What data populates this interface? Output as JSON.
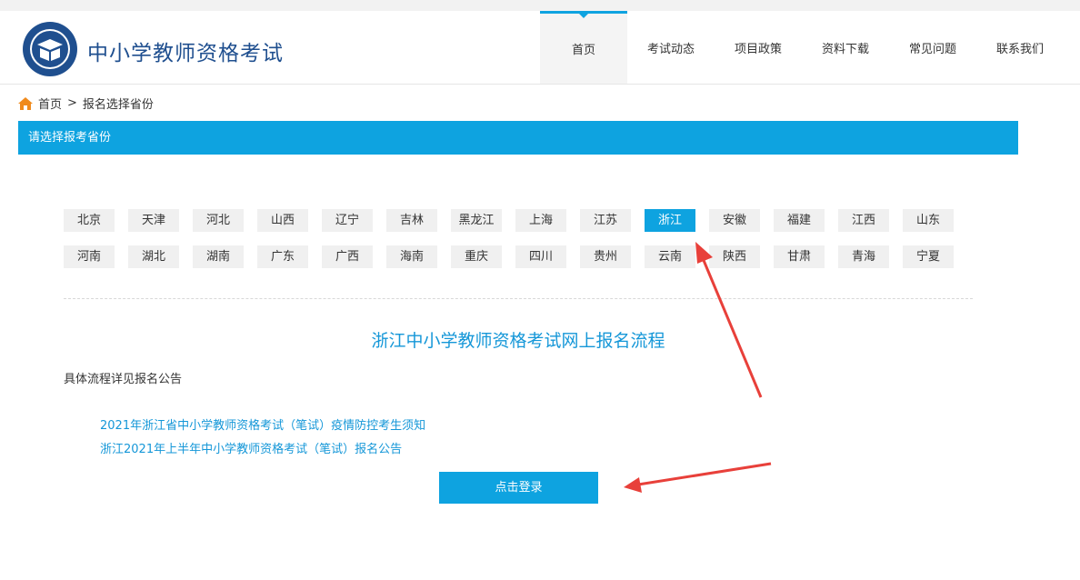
{
  "header": {
    "site_title": "中小学教师资格考试",
    "nav": [
      "首页",
      "考试动态",
      "项目政策",
      "资料下载",
      "常见问题",
      "联系我们"
    ],
    "active_nav_index": 0
  },
  "breadcrumb": {
    "home": "首页",
    "separator": ">",
    "current": "报名选择省份"
  },
  "section_bar": {
    "title": "请选择报考省份"
  },
  "provinces": {
    "row1": [
      "北京",
      "天津",
      "河北",
      "山西",
      "辽宁",
      "吉林",
      "黑龙江",
      "上海",
      "江苏",
      "浙江",
      "安徽",
      "福建",
      "江西",
      "山东"
    ],
    "row2": [
      "河南",
      "湖北",
      "湖南",
      "广东",
      "广西",
      "海南",
      "重庆",
      "四川",
      "贵州",
      "云南",
      "陕西",
      "甘肃",
      "青海",
      "宁夏"
    ],
    "selected": "浙江"
  },
  "flow": {
    "title": "浙江中小学教师资格考试网上报名流程",
    "note": "具体流程详见报名公告",
    "links": [
      "2021年浙江省中小学教师资格考试（笔试）疫情防控考生须知",
      "浙江2021年上半年中小学教师资格考试（笔试）报名公告"
    ],
    "login_button": "点击登录"
  },
  "colors": {
    "accent": "#0ea3e0",
    "title_blue": "#1f4f8f",
    "link": "#1597d8",
    "annotation_arrow": "#e8403a"
  },
  "icons": {
    "home": "home-icon",
    "logo": "exam-logo-icon"
  }
}
